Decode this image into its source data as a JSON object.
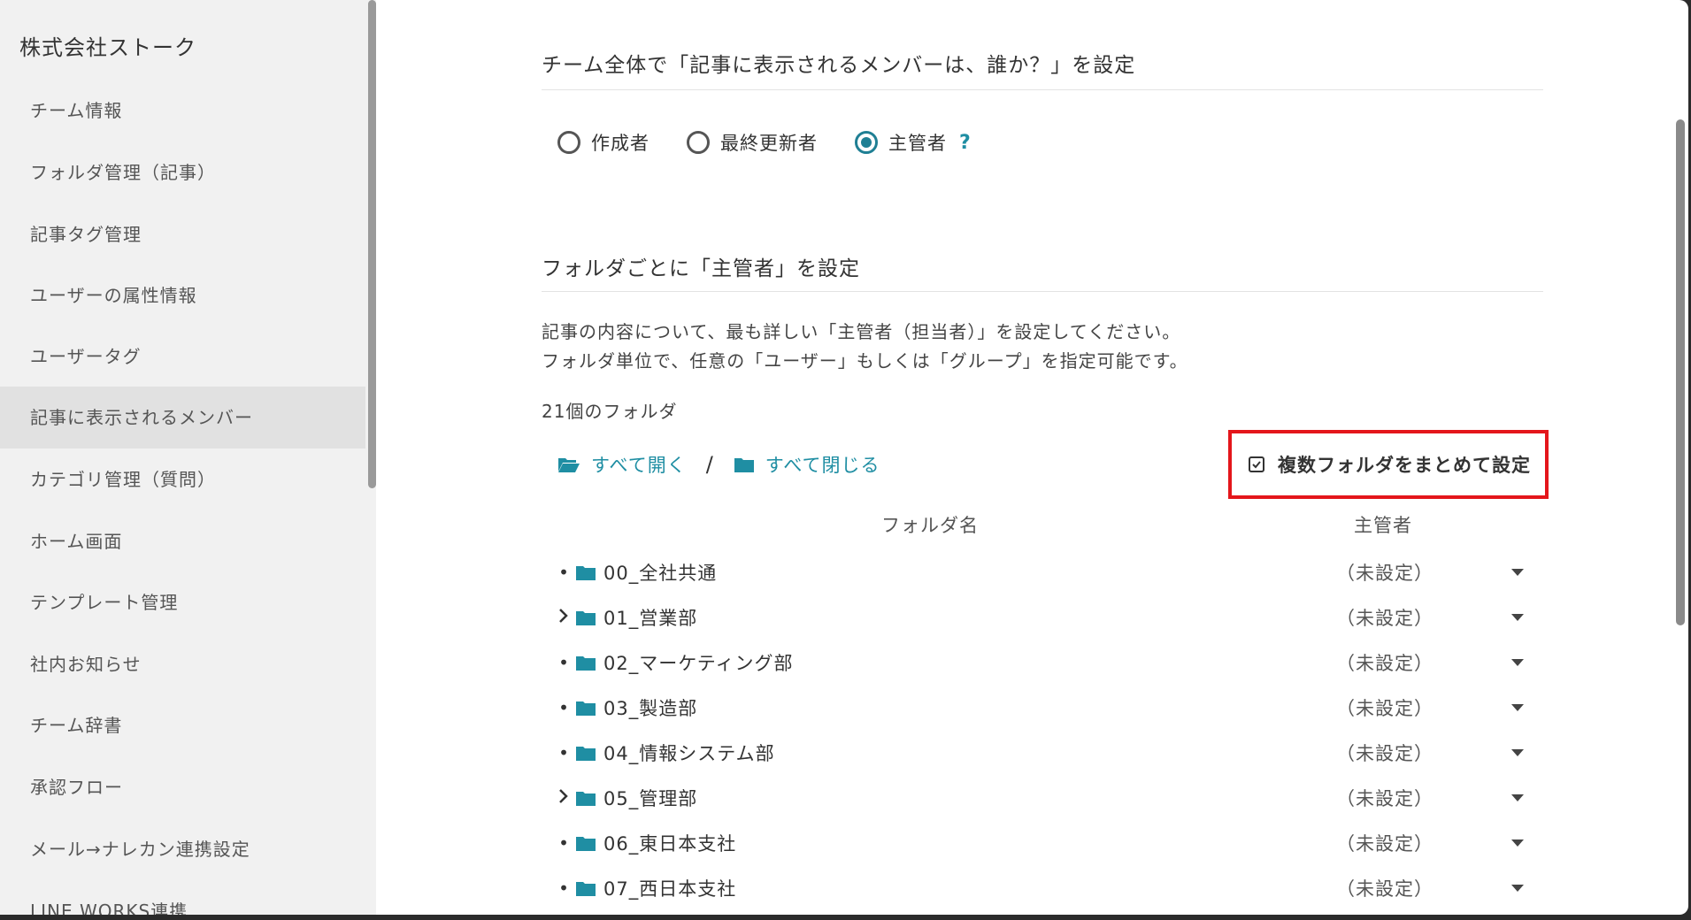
{
  "sidebar": {
    "org_name": "株式会社ストーク",
    "items": [
      {
        "label": "チーム情報"
      },
      {
        "label": "フォルダ管理（記事）"
      },
      {
        "label": "記事タグ管理"
      },
      {
        "label": "ユーザーの属性情報"
      },
      {
        "label": "ユーザータグ"
      },
      {
        "label": "記事に表示されるメンバー",
        "active": true
      },
      {
        "label": "カテゴリ管理（質問）"
      },
      {
        "label": "ホーム画面"
      },
      {
        "label": "テンプレート管理"
      },
      {
        "label": "社内お知らせ"
      },
      {
        "label": "チーム辞書"
      },
      {
        "label": "承認フロー"
      },
      {
        "label": "メール→ナレカン連携設定"
      },
      {
        "label": "LINE WORKS連携"
      }
    ]
  },
  "team_section": {
    "title": "チーム全体で「記事に表示されるメンバーは、誰か？」を設定",
    "options": [
      {
        "label": "作成者",
        "checked": false
      },
      {
        "label": "最終更新者",
        "checked": false
      },
      {
        "label": "主管者",
        "checked": true
      }
    ],
    "help_label": "?"
  },
  "folder_section": {
    "title": "フォルダごとに「主管者」を設定",
    "desc_line1": "記事の内容について、最も詳しい「主管者（担当者）」を設定してください。",
    "desc_line2": "フォルダ単位で、任意の「ユーザー」もしくは「グループ」を指定可能です。",
    "count": "21個のフォルダ",
    "expand_all": "すべて開く",
    "separator": "/",
    "collapse_all": "すべて閉じる",
    "bulk_button": "複数フォルダをまとめて設定",
    "col_folder": "フォルダ名",
    "col_owner": "主管者",
    "folders": [
      {
        "name": "00_全社共通",
        "owner": "（未設定）",
        "expandable": false
      },
      {
        "name": "01_営業部",
        "owner": "（未設定）",
        "expandable": true
      },
      {
        "name": "02_マーケティング部",
        "owner": "（未設定）",
        "expandable": false
      },
      {
        "name": "03_製造部",
        "owner": "（未設定）",
        "expandable": false
      },
      {
        "name": "04_情報システム部",
        "owner": "（未設定）",
        "expandable": false
      },
      {
        "name": "05_管理部",
        "owner": "（未設定）",
        "expandable": true
      },
      {
        "name": "06_東日本支社",
        "owner": "（未設定）",
        "expandable": false
      },
      {
        "name": "07_西日本支社",
        "owner": "（未設定）",
        "expandable": false
      }
    ]
  },
  "colors": {
    "accent": "#1f8ea3",
    "highlight_border": "#e4161b",
    "sidebar_bg": "#f1f1f1",
    "sidebar_active_bg": "#e1e1e1"
  }
}
